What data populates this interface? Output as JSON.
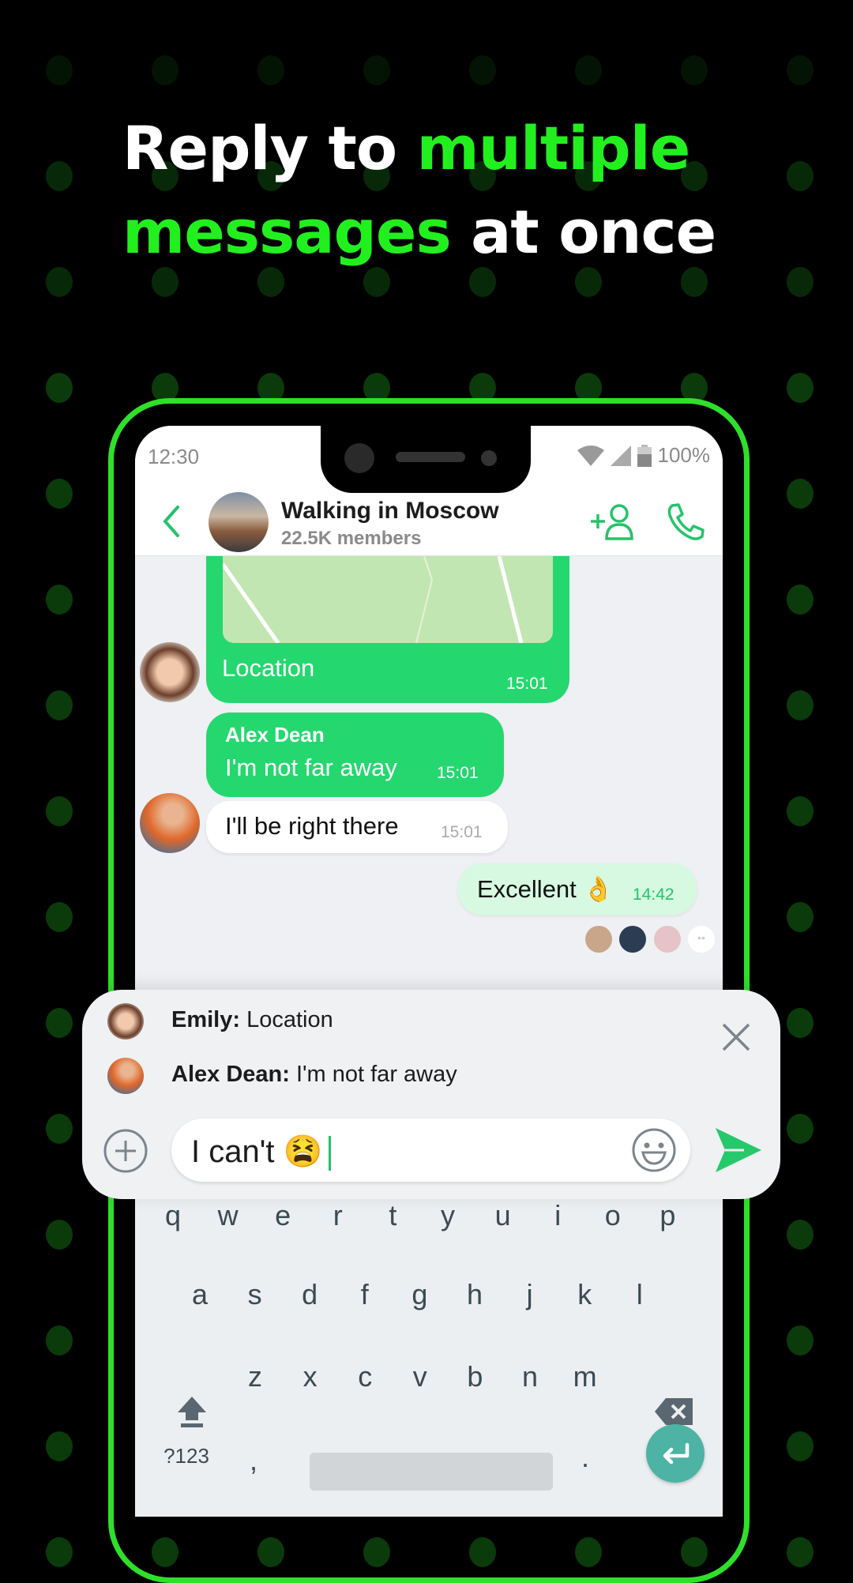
{
  "headline": {
    "line1_white": "Reply to ",
    "line1_green": "multiple",
    "line2_green": "messages",
    "line2_white": " at once"
  },
  "colors": {
    "accent": "#22f01e",
    "bubble_green": "#25d76f",
    "bubble_mine": "#d7f9e1",
    "enter_key": "#4cb3a5"
  },
  "status": {
    "time": "12:30",
    "battery": "100%"
  },
  "header": {
    "title": "Walking in Moscow",
    "subtitle": "22.5K members",
    "back_icon": "chevron-left-icon",
    "add_icon": "add-user-icon",
    "call_icon": "phone-icon"
  },
  "messages": [
    {
      "type": "location",
      "text": "Location",
      "time": "15:01"
    },
    {
      "sender": "Alex Dean",
      "text": "I'm not far away",
      "time": "15:01"
    },
    {
      "text": "I'll be right there",
      "time": "15:01"
    },
    {
      "text": "Excellent 👌",
      "time": "14:42",
      "mine": true
    }
  ],
  "reply": {
    "items": [
      {
        "name": "Emily:",
        "text": " Location"
      },
      {
        "name": "Alex Dean:",
        "text": " I'm not far away"
      }
    ],
    "input_value": "I can't 😫"
  },
  "keyboard": {
    "row1": [
      "q",
      "w",
      "e",
      "r",
      "t",
      "y",
      "u",
      "i",
      "o",
      "p"
    ],
    "row2": [
      "a",
      "s",
      "d",
      "f",
      "g",
      "h",
      "j",
      "k",
      "l"
    ],
    "row3": [
      "z",
      "x",
      "c",
      "v",
      "b",
      "n",
      "m"
    ],
    "symbols": "?123",
    "comma": ",",
    "period": "."
  }
}
